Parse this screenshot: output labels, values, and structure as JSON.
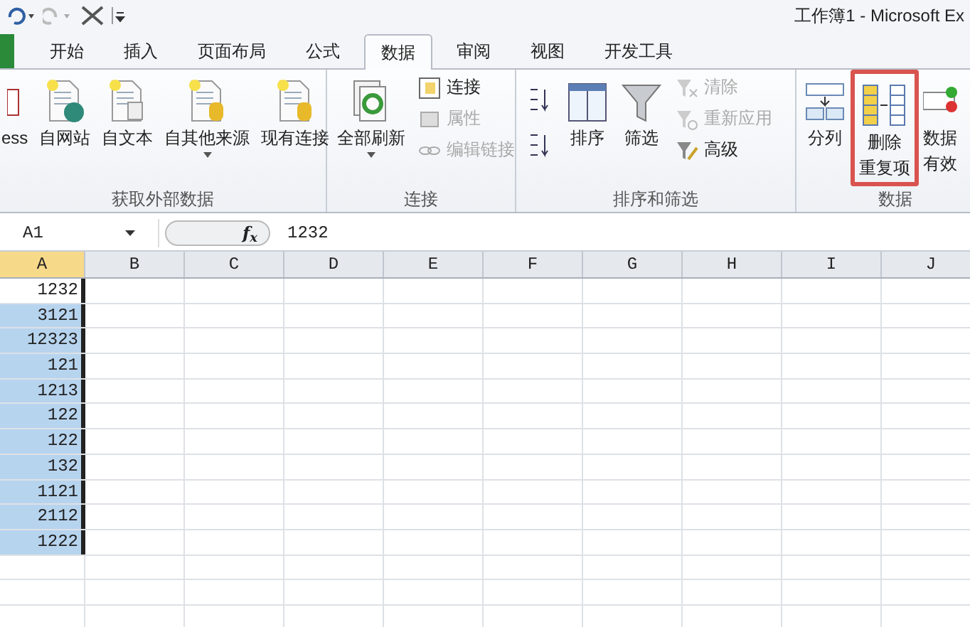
{
  "title": "工作簿1 - Microsoft Ex",
  "tabs": [
    {
      "label": "开始",
      "selected": false
    },
    {
      "label": "插入",
      "selected": false
    },
    {
      "label": "页面布局",
      "selected": false
    },
    {
      "label": "公式",
      "selected": false
    },
    {
      "label": "数据",
      "selected": true
    },
    {
      "label": "审阅",
      "selected": false
    },
    {
      "label": "视图",
      "selected": false
    },
    {
      "label": "开发工具",
      "selected": false
    }
  ],
  "ribbon_groups": [
    {
      "label": "获取外部数据",
      "items": [
        {
          "kind": "large",
          "lines": [
            "ess"
          ],
          "dropdown": false
        },
        {
          "kind": "large",
          "lines": [
            "自网站"
          ],
          "dropdown": false
        },
        {
          "kind": "large",
          "lines": [
            "自文本"
          ],
          "dropdown": false
        },
        {
          "kind": "large",
          "lines": [
            "自其他来源"
          ],
          "dropdown": true
        },
        {
          "kind": "large",
          "lines": [
            "现有连接"
          ],
          "dropdown": false
        }
      ]
    },
    {
      "label": "连接",
      "items": [
        {
          "kind": "large",
          "lines": [
            "全部刷新"
          ],
          "dropdown": true
        },
        {
          "kind": "stack",
          "entries": [
            {
              "label": "连接",
              "disabled": false
            },
            {
              "label": "属性",
              "disabled": true
            },
            {
              "label": "编辑链接",
              "disabled": true
            }
          ]
        }
      ]
    },
    {
      "label": "排序和筛选",
      "items": [
        {
          "kind": "sortpair"
        },
        {
          "kind": "large",
          "lines": [
            "排序"
          ],
          "dropdown": false
        },
        {
          "kind": "large",
          "lines": [
            "筛选"
          ],
          "dropdown": false
        },
        {
          "kind": "stack",
          "entries": [
            {
              "label": "清除",
              "disabled": true
            },
            {
              "label": "重新应用",
              "disabled": true
            },
            {
              "label": "高级",
              "disabled": false
            }
          ]
        }
      ]
    },
    {
      "label": "数据",
      "items": [
        {
          "kind": "large",
          "lines": [
            "分列"
          ],
          "dropdown": false,
          "highlighted": false
        },
        {
          "kind": "large",
          "lines": [
            "删除",
            "重复项"
          ],
          "dropdown": false,
          "highlighted": true
        },
        {
          "kind": "large",
          "lines": [
            "数据",
            "有效"
          ],
          "dropdown": false,
          "highlighted": false
        }
      ]
    }
  ],
  "name_box": "A1",
  "function_label": "f$_{x}$",
  "formula": "1232",
  "columns": [
    {
      "label": "A",
      "selected": true
    },
    {
      "label": "B",
      "selected": false
    },
    {
      "label": "C",
      "selected": false
    },
    {
      "label": "D",
      "selected": false
    },
    {
      "label": "E",
      "selected": false
    },
    {
      "label": "F",
      "selected": false
    },
    {
      "label": "G",
      "selected": false
    },
    {
      "label": "H",
      "selected": false
    },
    {
      "label": "I",
      "selected": false
    },
    {
      "label": "J",
      "selected": false
    }
  ],
  "cells": [
    {
      "value": "1232",
      "active": true
    },
    {
      "value": "3121",
      "active": false
    },
    {
      "value": "12323",
      "active": false
    },
    {
      "value": "121",
      "active": false
    },
    {
      "value": "1213",
      "active": false
    },
    {
      "value": "122",
      "active": false
    },
    {
      "value": "122",
      "active": false
    },
    {
      "value": "132",
      "active": false
    },
    {
      "value": "1121",
      "active": false
    },
    {
      "value": "2112",
      "active": false
    },
    {
      "value": "1222",
      "active": false
    }
  ]
}
